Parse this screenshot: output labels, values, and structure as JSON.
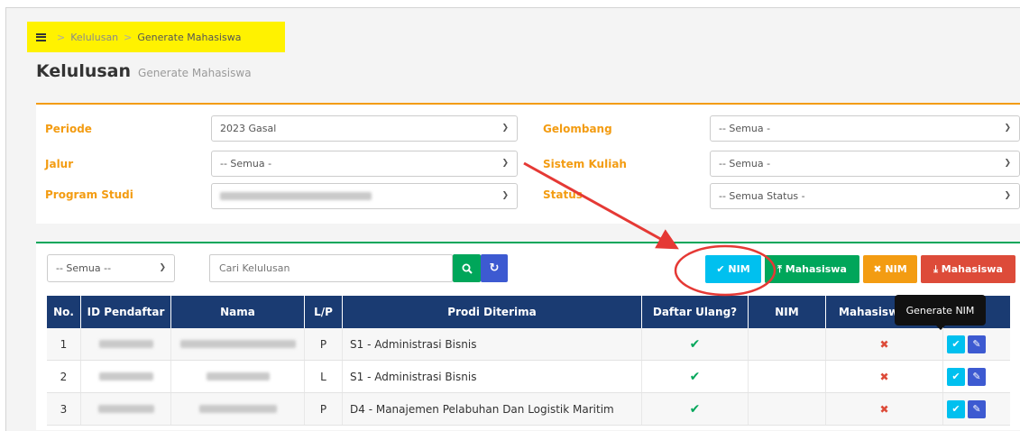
{
  "breadcrumb": {
    "item1": "Kelulusan",
    "item2": "Generate Mahasiswa",
    "separator": ">"
  },
  "header": {
    "title": "Kelulusan",
    "subtitle": "Generate Mahasiswa"
  },
  "filters": {
    "periode": {
      "label": "Periode",
      "value": "2023 Gasal"
    },
    "jalur": {
      "label": "Jalur",
      "value": "-- Semua -"
    },
    "program_studi": {
      "label": "Program Studi",
      "value": ""
    },
    "gelombang": {
      "label": "Gelombang",
      "value": "-- Semua -"
    },
    "sistem_kuliah": {
      "label": "Sistem Kuliah",
      "value": "-- Semua -"
    },
    "status": {
      "label": "Status",
      "value": "-- Semua Status -"
    }
  },
  "toolbar": {
    "filter_select": "-- Semua --",
    "search_placeholder": "Cari Kelulusan",
    "btn_nim": "✔ NIM",
    "btn_mahasiswa": "⤒ Mahasiswa",
    "btn_cancel_nim": "✖ NIM",
    "btn_delete_mahasiswa": "⤓ Mahasiswa"
  },
  "tooltip": "Generate NIM",
  "table": {
    "headers": [
      "No.",
      "ID Pendaftar",
      "Nama",
      "L/P",
      "Prodi Diterima",
      "Daftar Ulang?",
      "NIM",
      "Mahasisw"
    ],
    "rows": [
      {
        "no": "1",
        "lp": "P",
        "prodi": "S1 - Administrasi Bisnis"
      },
      {
        "no": "2",
        "lp": "L",
        "prodi": "S1 - Administrasi Bisnis"
      },
      {
        "no": "3",
        "lp": "P",
        "prodi": "D4 - Manajemen Pelabuhan Dan Logistik Maritim"
      }
    ]
  },
  "colors": {
    "accent_orange": "#f39c12",
    "green": "#00a65a",
    "navy": "#1a3b72",
    "info": "#00c0ef",
    "red": "#dd4b39",
    "annotation_red": "#e53935",
    "highlight": "#fff200"
  },
  "icons": {
    "menu": "hamburger-icon",
    "search": "search-icon",
    "refresh": "refresh-icon",
    "chevron": "chevron-down-icon",
    "check": "check-icon",
    "edit": "pencil-icon"
  }
}
